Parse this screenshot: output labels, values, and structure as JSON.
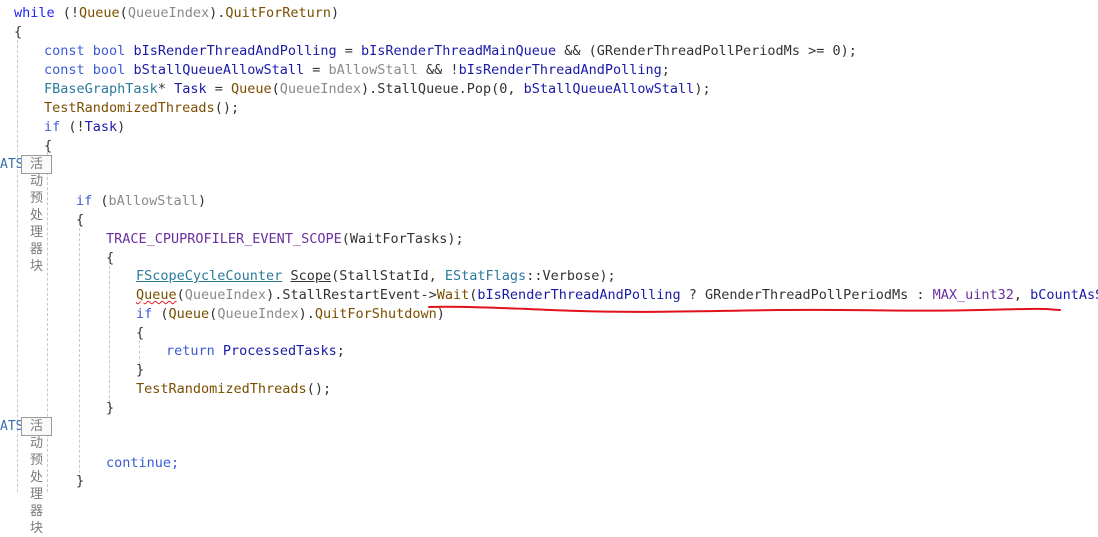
{
  "region_prefix": "ATS",
  "region_label": "活动预处理器块",
  "tokens": {
    "while": "while",
    "if": "if",
    "const": "const",
    "bool": "bool",
    "return": "return",
    "continue": "continue;",
    "Queue": "Queue",
    "QueueIndex": "QueueIndex",
    "QuitForReturn": "QuitForReturn",
    "QuitForShutdown": "QuitForShutdown",
    "bIsRenderThreadAndPolling": "bIsRenderThreadAndPolling",
    "bIsRenderThreadMainQueue": "bIsRenderThreadMainQueue",
    "GRenderThreadPollPeriodMs": "GRenderThreadPollPeriodMs",
    "bStallQueueAllowStall": "bStallQueueAllowStall",
    "bAllowStall": "bAllowStall",
    "FBaseGraphTask": "FBaseGraphTask",
    "Task": "Task",
    "StallQueue": "StallQueue",
    "Pop": "Pop",
    "TestRandomizedThreads": "TestRandomizedThreads",
    "TRACE_CPUPROFILER_EVENT_SCOPE": "TRACE_CPUPROFILER_EVENT_SCOPE",
    "WaitForTasks": "WaitForTasks",
    "FScopeCycleCounter": "FScopeCycleCounter",
    "Scope": "Scope",
    "StallStatId": "StallStatId",
    "EStatFlags": "EStatFlags",
    "Verbose": "Verbose",
    "StallRestartEvent": "StallRestartEvent",
    "Wait": "Wait",
    "MAX_uint32": "MAX_uint32",
    "bCountAsStall": "bCountAsStall",
    "ProcessedTasks": "ProcessedTasks"
  }
}
